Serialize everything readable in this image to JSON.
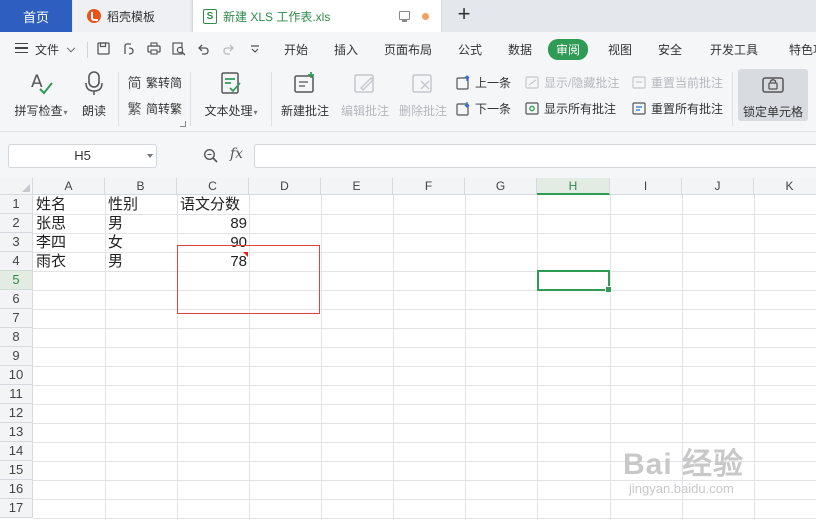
{
  "tabs": {
    "home": "首页",
    "docer": "稻壳模板",
    "file_prefix": "S",
    "file": "新建 XLS 工作表.xls"
  },
  "menu": {
    "file": "文件",
    "items": [
      "开始",
      "插入",
      "页面布局",
      "公式",
      "数据",
      "审阅",
      "视图",
      "安全",
      "开发工具",
      "特色功"
    ],
    "selected": "审阅"
  },
  "ribbon": {
    "spellcheck": "拼写检查",
    "read_aloud": "朗读",
    "trad_to_simp": "繁转简",
    "simp_to_trad": "简转繁",
    "text_processing": "文本处理",
    "new_comment": "新建批注",
    "edit_comment": "编辑批注",
    "delete_comment": "删除批注",
    "prev": "上一条",
    "next": "下一条",
    "show_hide_comment": "显示/隐藏批注",
    "show_all_comments": "显示所有批注",
    "reset_current_comment": "重置当前批注",
    "reset_all_comments": "重置所有批注",
    "lock_cell": "锁定单元格"
  },
  "formula": {
    "name_box": "H5",
    "fx": "fx",
    "value": ""
  },
  "sheet": {
    "columns": [
      "A",
      "B",
      "C",
      "D",
      "E",
      "F",
      "G",
      "H",
      "I",
      "J",
      "K"
    ],
    "rows": [
      "1",
      "2",
      "3",
      "4",
      "5",
      "6",
      "7",
      "8",
      "9",
      "10",
      "11",
      "12",
      "13",
      "14",
      "15",
      "16",
      "17"
    ],
    "selected_column": "H",
    "selected_row": "5",
    "cells": {
      "A1": "姓名",
      "B1": "性别",
      "C1": "语文分数",
      "A2": "张思",
      "B2": "男",
      "C2": "89",
      "A3": "李四",
      "B3": "女",
      "C3": "90",
      "A4": "雨衣",
      "B4": "男",
      "C4": "78"
    }
  },
  "watermark": {
    "line1": "Bai 经验",
    "line2": "jingyan.baidu.com"
  },
  "colors": {
    "accent_green": "#2f9b55",
    "home_tab_blue": "#2e5fc0",
    "annotation_red": "#e04040"
  }
}
